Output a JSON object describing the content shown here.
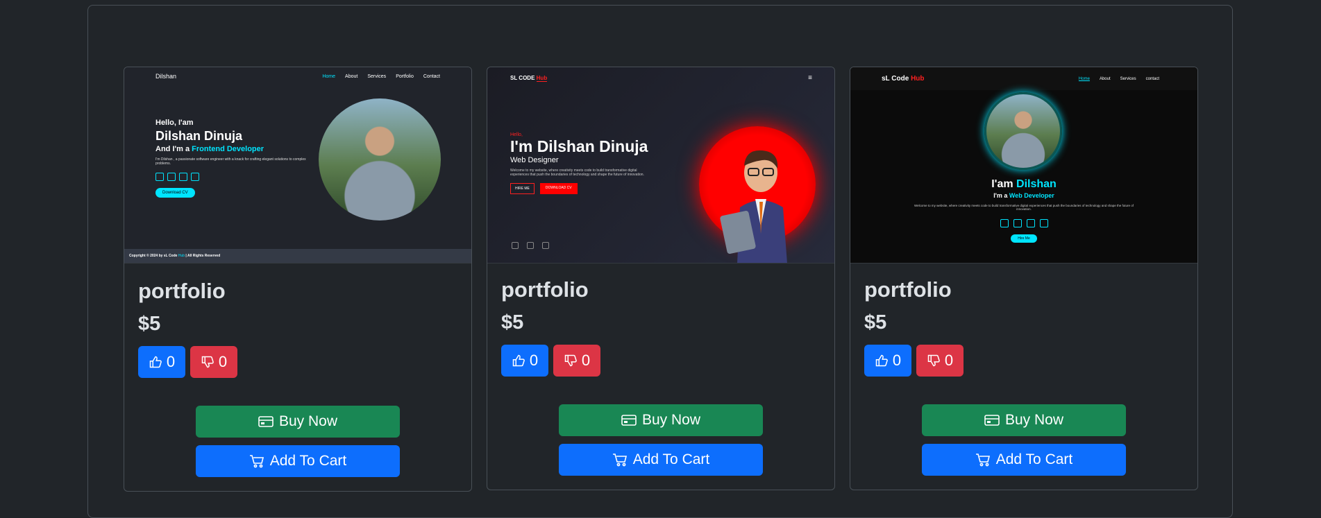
{
  "cards": [
    {
      "title": "portfolio",
      "price": "$5",
      "likes": "0",
      "dislikes": "0",
      "buy_label": "Buy Now",
      "cart_label": "Add To Cart",
      "thumb": {
        "brand": "Dilshan",
        "nav": [
          "Home",
          "About",
          "Services",
          "Portfolio",
          "Contact"
        ],
        "greeting": "Hello, I'am",
        "name": "Dilshan Dinuja",
        "role_prefix": "And I'm a",
        "role": "Frontend Developer",
        "blurb": "I'm Dilshan , a passionate software engineer with a knack for crafting elegant solutions to complex problems.",
        "cta": "Download CV",
        "footer_pre": "Copyright © 2024 by sL Code",
        "footer_hub": "Hub",
        "footer_post": "| All Rights Reserved"
      }
    },
    {
      "title": "portfolio",
      "price": "$5",
      "likes": "0",
      "dislikes": "0",
      "buy_label": "Buy Now",
      "cart_label": "Add To Cart",
      "thumb": {
        "brand": "SL CODE",
        "brand_hub": "Hub",
        "menu": "≡",
        "greeting": "Hello,",
        "name": "I'm Dilshan Dinuja",
        "role": "Web Designer",
        "blurb": "Welcome to my website, where creativity meets code to build transformative digital experiences that push the boundaries of technology and shape the future of innovation.",
        "btn1": "HIRE ME",
        "btn2": "DOWNLOAD CV"
      }
    },
    {
      "title": "portfolio",
      "price": "$5",
      "likes": "0",
      "dislikes": "0",
      "buy_label": "Buy Now",
      "cart_label": "Add To Cart",
      "thumb": {
        "brand": "sL Code",
        "brand_hub": "Hub",
        "nav": [
          "Home",
          "About",
          "Services",
          "contact"
        ],
        "iam": "I'am",
        "name": "Dilshan",
        "role_prefix": "I'm a",
        "role": "Web Developer",
        "blurb": "Welcome to my website, where creativity meets code to build transformative digital experiences that push the boundaries of technology and shape the future of innovation.",
        "cta": "Hire Me"
      }
    }
  ],
  "icons": {
    "like": "thumbs-up-icon",
    "dislike": "thumbs-down-icon",
    "buy": "credit-card-icon",
    "cart": "cart-icon"
  },
  "colors": {
    "background": "#212529",
    "primary": "#0d6efd",
    "danger": "#dc3545",
    "success": "#198754",
    "accent_cyan": "#00e5ff",
    "accent_red": "#ff0000"
  }
}
